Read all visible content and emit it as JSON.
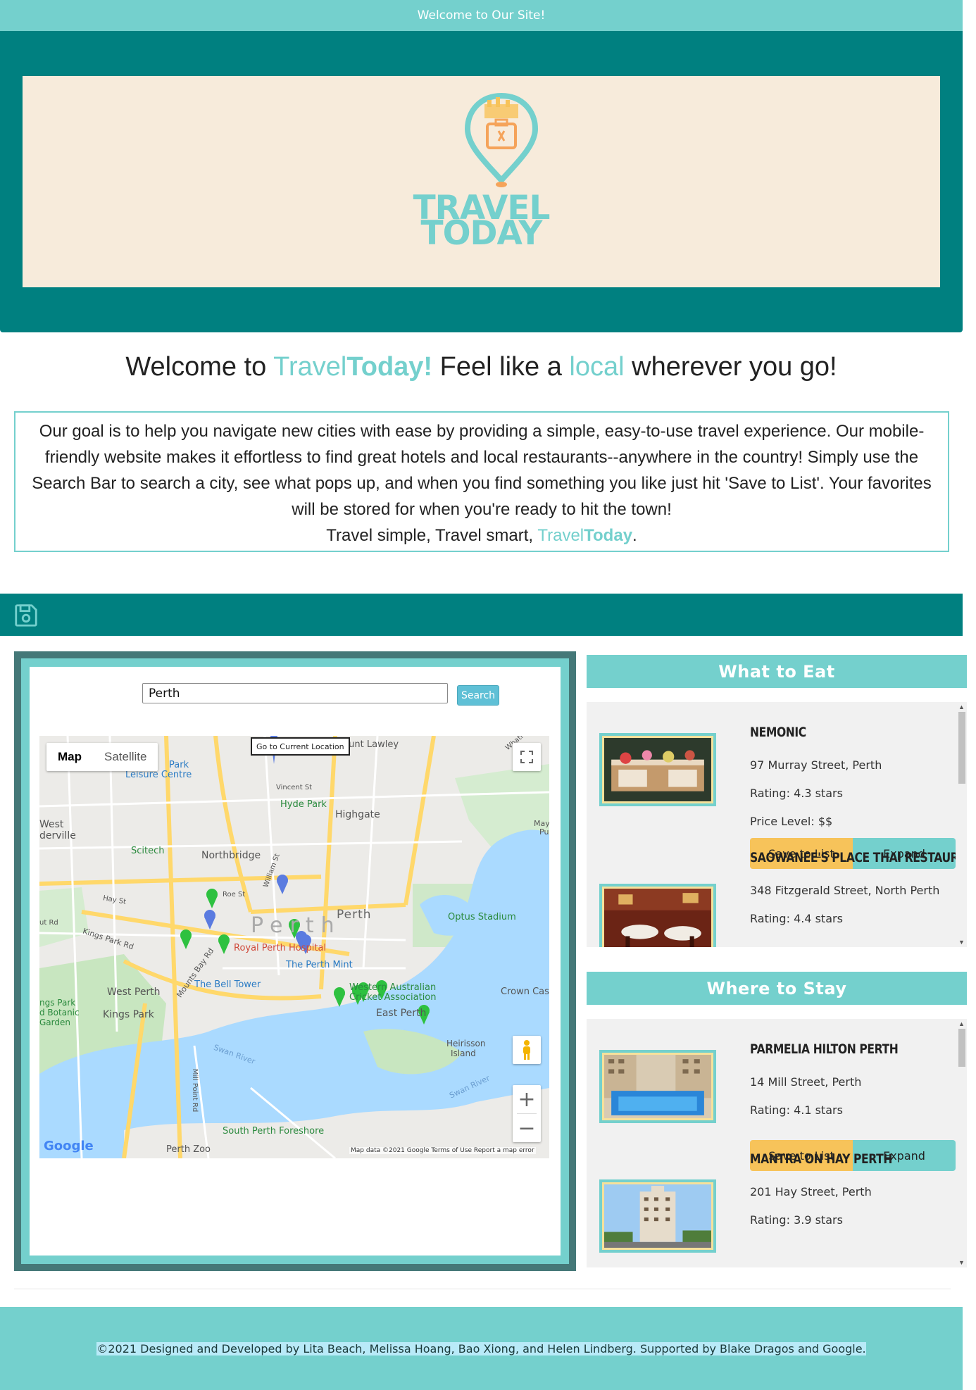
{
  "topbar": {
    "text": "Welcome to Our Site!"
  },
  "hero": {
    "logo_line1": "TRAVEL",
    "logo_line2": "TODAY"
  },
  "welcome": {
    "part1": "Welcome to ",
    "brand_a": "Travel",
    "brand_b": "Today!",
    "part2": " Feel like a ",
    "local": "local",
    "part3": " wherever you go!"
  },
  "intro": {
    "text": "Our goal is to help you navigate new cities with ease by providing a simple, easy-to-use travel experience. Our mobile-friendly website makes it effortless to find great hotels and local restaurants--anywhere in the country! Simply use the Search Bar to search a city, see what pops up, and when you find something you like just hit 'Save to List'. Your favorites will be stored for when you're ready to hit the town!",
    "tagline_a": "Travel simple, Travel smart, ",
    "brand_a": "Travel",
    "brand_b": "Today",
    "tagline_end": "."
  },
  "search": {
    "value": "Perth",
    "button": "Search"
  },
  "map": {
    "type_map": "Map",
    "type_satellite": "Satellite",
    "goto": "Go to Current Location",
    "google": "Google",
    "attribution": "Map data ©2021 Google    Terms of Use    Report a map error",
    "labels": {
      "mount_lawley": "Mount Lawley",
      "park": "Park",
      "leisure_centre": "Leisure Centre",
      "vincent_st": "Vincent St",
      "hyde_park": "Hyde Park",
      "highgate": "Highgate",
      "west": "West",
      "derville": "derville",
      "scitech": "Scitech",
      "northbridge": "Northbridge",
      "perth_big": "Perth",
      "perth_small": "Perth",
      "optus": "Optus Stadium",
      "royal_perth": "Royal Perth Hospital",
      "kings_park_rd": "Kings Park Rd",
      "mounts_bay": "Mounts Bay Rd",
      "perth_mint": "The Perth Mint",
      "bell_tower": "The Bell Tower",
      "west_perth": "West Perth",
      "wa_cricket_1": "Western Australian",
      "wa_cricket_2": "Cricket Association",
      "crown": "Crown Cas",
      "kings_park": "Kings Park",
      "botanic_1": "ngs Park",
      "botanic_2": "d Botanic",
      "botanic_3": "Garden",
      "east_perth": "East Perth",
      "swan_river": "Swan River",
      "swan_river_2": "Swan River",
      "heirisson_1": "Heirisson",
      "heirisson_2": "Island",
      "south_perth": "South Perth Foreshore",
      "perth_zoo": "Perth Zoo",
      "mill_point": "Mill Point Rd",
      "roe_st": "Roe St",
      "hay_st": "Hay St",
      "william_st": "William St",
      "whatl": "Whatl",
      "may_1": "May",
      "may_2": "Pu",
      "rd": "ut Rd"
    }
  },
  "eat": {
    "title": "What to Eat",
    "items": [
      {
        "name": "NEMONIC",
        "address": "97 Murray Street, Perth",
        "rating": "Rating: 4.3 stars",
        "price": "Price Level: $$"
      },
      {
        "name": "SAOWANEE'S PLACE THAI RESTAURANT",
        "address": "348 Fitzgerald Street, North Perth",
        "rating": "Rating: 4.4 stars"
      }
    ]
  },
  "stay": {
    "title": "Where to Stay",
    "items": [
      {
        "name": "PARMELIA HILTON PERTH",
        "address": "14 Mill Street, Perth",
        "rating": "Rating: 4.1 stars"
      },
      {
        "name": "MANTRA ON HAY PERTH",
        "address": "201 Hay Street, Perth",
        "rating": "Rating: 3.9 stars"
      }
    ]
  },
  "buttons": {
    "save": "Save to List",
    "expand": "Expand"
  },
  "footer": {
    "text": "©2021 Designed and Developed by Lita Beach, Melissa Hoang, Bao Xiong, and Helen Lindberg. Supported by Blake Dragos and Google."
  },
  "colors": {
    "teal": "#74d0cd",
    "dark_teal": "#008080",
    "cream": "#f7ebdb",
    "save_yellow": "#f7c35a"
  }
}
